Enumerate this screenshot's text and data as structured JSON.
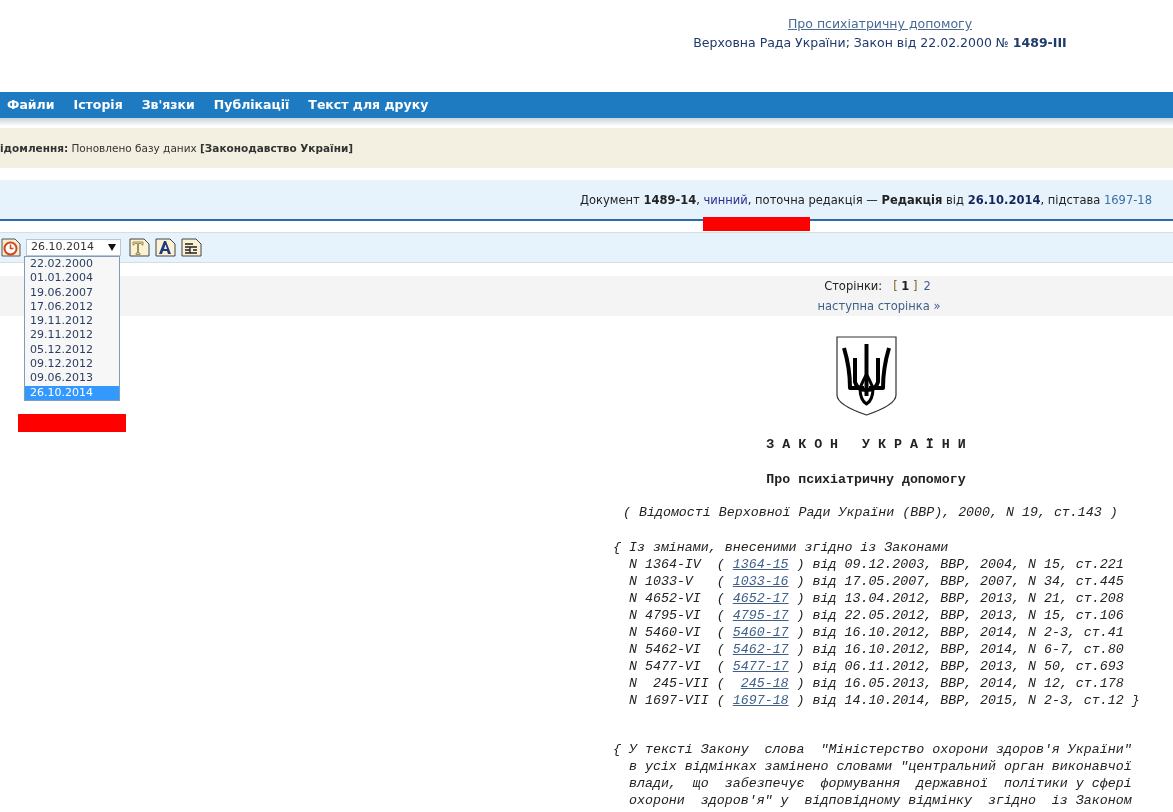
{
  "header": {
    "title_link": "Про психіатричну допомогу",
    "subtitle": "Верховна Рада України; Закон від 22.02.2000 № **1489-III**"
  },
  "nav": [
    "Файли",
    "Історія",
    "Зв'язки",
    "Публікації",
    "Текст для друку"
  ],
  "notice": "**ідомлення:** Поновлено базу даних **[Законодавство України]**",
  "status": {
    "pre": "Документ **1489-14**, ",
    "state_link": "чинний",
    "mid": ", поточна редакція — **Редакція** від ",
    "date_link": "26.10.2014",
    "post": ", підстава ",
    "basis_link": "1697-18"
  },
  "toolbar": {
    "select_value": "26.10.2014",
    "expanded": true,
    "options": [
      {
        "label": "22.02.2000",
        "selected": false
      },
      {
        "label": "01.01.2004",
        "selected": false
      },
      {
        "label": "19.06.2007",
        "selected": false
      },
      {
        "label": "17.06.2012",
        "selected": false
      },
      {
        "label": "19.11.2012",
        "selected": false
      },
      {
        "label": "29.11.2012",
        "selected": false
      },
      {
        "label": "05.12.2012",
        "selected": false
      },
      {
        "label": "09.12.2012",
        "selected": false
      },
      {
        "label": "09.06.2013",
        "selected": false
      },
      {
        "label": "26.10.2014",
        "selected": true
      }
    ]
  },
  "pagination": {
    "label": "Сторінки:",
    "open_bracket": "[",
    "close_bracket": "]",
    "pages": [
      {
        "label": "1",
        "selected": true
      },
      {
        "label": "2",
        "selected": false
      }
    ],
    "next": "наступна сторінка »"
  },
  "document": {
    "heading": "З А К О Н   У К Р А Ї Н И",
    "title": "Про психіатричну допомогу",
    "source": "( Відомості Верховної Ради України (ВВР), 2000, N 19, ст.143 )",
    "amendments_intro": "{ Із змінами, внесеними згідно із Законами",
    "amendments": [
      {
        "pre": "N 1364-IV  ( ",
        "link": "1364-15",
        "post": " ) від 09.12.2003, ВВР, 2004, N 15, ст.221"
      },
      {
        "pre": "N 1033-V   ( ",
        "link": "1033-16",
        "post": " ) від 17.05.2007, ВВР, 2007, N 34, ст.445"
      },
      {
        "pre": "N 4652-VI  ( ",
        "link": "4652-17",
        "post": " ) від 13.04.2012, ВВР, 2013, N 21, ст.208"
      },
      {
        "pre": "N 4795-VI  ( ",
        "link": "4795-17",
        "post": " ) від 22.05.2012, ВВР, 2013, N 15, ст.106"
      },
      {
        "pre": "N 5460-VI  ( ",
        "link": "5460-17",
        "post": " ) від 16.10.2012, ВВР, 2014, N 2-3, ст.41"
      },
      {
        "pre": "N 5462-VI  ( ",
        "link": "5462-17",
        "post": " ) від 16.10.2012, ВВР, 2014, N 6-7, ст.80"
      },
      {
        "pre": "N 5477-VI  ( ",
        "link": "5477-17",
        "post": " ) від 06.11.2012, ВВР, 2013, N 50, ст.693"
      },
      {
        "pre": "N  245-VII (  ",
        "link": "245-18",
        "post": " ) від 16.05.2013, ВВР, 2014, N 12, ст.178"
      },
      {
        "pre": "N 1697-VII ( ",
        "link": "1697-18",
        "post": " ) від 14.10.2014, ВВР, 2015, N 2-3, ст.12 }"
      }
    ],
    "note_lines": [
      "{ У тексті Закону  слова  \"Міністерство охорони здоров'я України\"",
      "  в усіх відмінках замінено словами \"центральний орган виконавчої",
      "  влади,  що  забезпечує  формування  державної  політики у сфері",
      "  охорони  здоров'я\" у  відповідному відмінку  згідно  із Законом"
    ]
  }
}
